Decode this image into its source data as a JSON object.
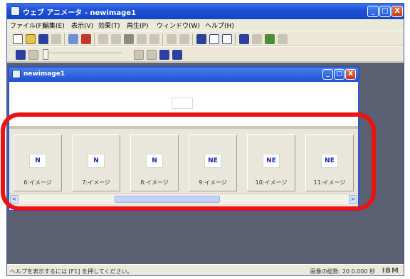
{
  "app": {
    "title": "ウェブ アニメータ - newimage1",
    "caption_buttons": {
      "minimize": "_",
      "maximize": "□",
      "close": "X"
    }
  },
  "menubar": {
    "items": [
      {
        "label": "ファイル(F)"
      },
      {
        "label": "編集(E)"
      },
      {
        "label": "表示(V)"
      },
      {
        "label": "効果(T)"
      },
      {
        "label": "再生(P)"
      },
      {
        "label": "ウィンドウ(W)"
      },
      {
        "label": "ヘルプ(H)"
      }
    ]
  },
  "toolbar": {
    "icons": [
      "new-icon",
      "open-icon",
      "save-icon",
      "print-icon",
      "properties-icon",
      "color-icon",
      "cut-icon",
      "copy-icon",
      "paste-icon",
      "delete-icon",
      "undo-icon",
      "redo-icon",
      "image-icon",
      "frame-icon",
      "grid-icon",
      "insert-image-icon",
      "text-icon",
      "effect-icon",
      "preview-icon"
    ],
    "colors": {
      "dark": "#2d3fa0",
      "mid": "#6d8fd6",
      "disabled": "#c9c6b8",
      "accent": "#c23a2a"
    }
  },
  "player": {
    "buttons": [
      "play-icon",
      "stop-icon",
      "first-frame-icon",
      "prev-frame-icon",
      "next-frame-icon",
      "last-frame-icon"
    ]
  },
  "child_window": {
    "title": "newimage1",
    "caption_buttons": {
      "minimize": "_",
      "maximize": "□",
      "close": "X"
    }
  },
  "frames": [
    {
      "glyph": "N",
      "label": "6:イメージ"
    },
    {
      "glyph": "N",
      "label": "7:イメージ"
    },
    {
      "glyph": "N",
      "label": "8:イメージ"
    },
    {
      "glyph": "NE",
      "label": "9:イメージ"
    },
    {
      "glyph": "NE",
      "label": "10:イメージ"
    },
    {
      "glyph": "NE",
      "label": "11:イメージ"
    }
  ],
  "scrollbar": {
    "left_arrow": "<",
    "right_arrow": ">"
  },
  "statusbar": {
    "left_text": "ヘルプを表示するには [F1] を押してください。",
    "right_text": "画像の総数: 20 0.000 秒",
    "logo": "IBM"
  },
  "annotation_color": "#ee1111"
}
